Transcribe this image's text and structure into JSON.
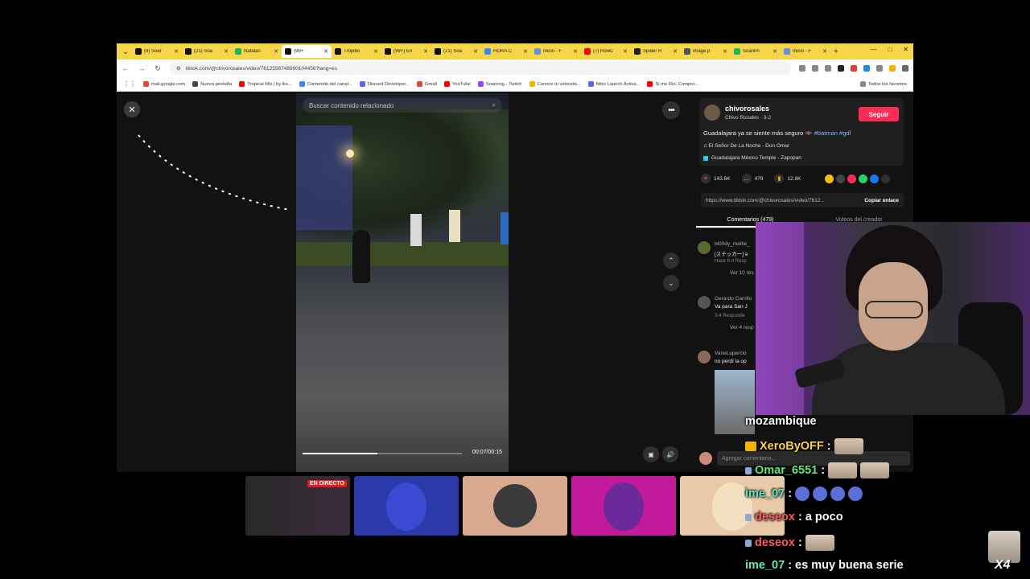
{
  "browser": {
    "tabs": [
      {
        "label": "(8) Soar",
        "color": "#111111"
      },
      {
        "label": "(21) Soa",
        "color": "#111111"
      },
      {
        "label": "Natalan",
        "color": "#1db954"
      },
      {
        "label": "(99+",
        "color": "#111111",
        "active": true
      },
      {
        "label": "Tropibo",
        "color": "#111111"
      },
      {
        "label": "(99+) En",
        "color": "#111111"
      },
      {
        "label": "(21) Soa",
        "color": "#111111"
      },
      {
        "label": "HORA C",
        "color": "#4285f4"
      },
      {
        "label": "Inicio - F",
        "color": "#6a8fd8"
      },
      {
        "label": "(7) RowC",
        "color": "#ff0000"
      },
      {
        "label": "Spider R",
        "color": "#222222"
      },
      {
        "label": "image.p",
        "color": "#555555"
      },
      {
        "label": "Soarinn",
        "color": "#1db954"
      },
      {
        "label": "Inicio - F",
        "color": "#6a8fd8"
      }
    ],
    "url": "tiktok.com/@chivorosales/video/7612558748980104456?lang=es",
    "bookmarks": [
      {
        "label": "mail.google.com",
        "color": "#ea4335"
      },
      {
        "label": "Nueva pestaña",
        "color": "#444444"
      },
      {
        "label": "Tropical Mix | by iks...",
        "color": "#ff0000"
      },
      {
        "label": "Contenido del canal...",
        "color": "#4285f4"
      },
      {
        "label": "Discord Developer...",
        "color": "#5865f2"
      },
      {
        "label": "Gmail",
        "color": "#ea4335"
      },
      {
        "label": "YouTube",
        "color": "#ff0000"
      },
      {
        "label": "Soarinng - Twitch",
        "color": "#9146ff"
      },
      {
        "label": "Conoce tu velocida...",
        "color": "#f2b200"
      },
      {
        "label": "Nitro Launch Activa...",
        "color": "#5865f2"
      },
      {
        "label": "Si me Rio, Compro...",
        "color": "#ff0000"
      }
    ],
    "all_favorites": "Todos los favoritos"
  },
  "video": {
    "search_placeholder": "Buscar contenido relacionado",
    "time": "00:07/00:15",
    "progress": 0.47
  },
  "author": {
    "username": "chivorosales",
    "display": "Chivo Rosales · 3-2",
    "follow_label": "Seguir",
    "caption": "Guadalajara ya se siente más seguro 🦇",
    "tags": "#batman #gdl",
    "music": "♫ El Señor De La Noche - Don Omar",
    "location": "Guadalajara México Temple - Zapopan"
  },
  "stats": {
    "likes": "143.6K",
    "comments": "479",
    "saves": "12.8K"
  },
  "link": {
    "url": "https://www.tiktok.com/@chivorosales/video/7612...",
    "copy_label": "Copiar enlace"
  },
  "comment_tabs": {
    "comments": "Comentarios (479)",
    "creator": "Videos del creador"
  },
  "comments": [
    {
      "name": "bl00dy_mattie_",
      "text": "[ステッカー] e",
      "meta": "Hace 6 d  Resp",
      "more": "Ver 10 res"
    },
    {
      "name": "Gerardo Carrillo",
      "text": "Va para San J",
      "meta": "3-4  Responde",
      "more": "Ver 4 resp"
    },
    {
      "name": "VaneLupercio",
      "text": "no perdí la op",
      "meta": "",
      "more": ""
    }
  ],
  "comment_input_placeholder": "Agregar comentario...",
  "thumbs": {
    "live_label": "EN DIRECTO"
  },
  "chat": [
    {
      "user": "mozambique",
      "sep": "",
      "msg": ""
    },
    {
      "user": "XeroByOFF",
      "sep": ":",
      "msg": ""
    },
    {
      "user": "Omar_6551",
      "sep": ":",
      "msg": ""
    },
    {
      "user": "ime_07",
      "sep": ":",
      "msg": ""
    },
    {
      "user": "deseox",
      "sep": ":",
      "msg": "a poco"
    },
    {
      "user": "deseox",
      "sep": ":",
      "msg": ""
    },
    {
      "user": "ime_07",
      "sep": ":",
      "msg": "es muy buena serie"
    }
  ],
  "emote_count": "X4"
}
